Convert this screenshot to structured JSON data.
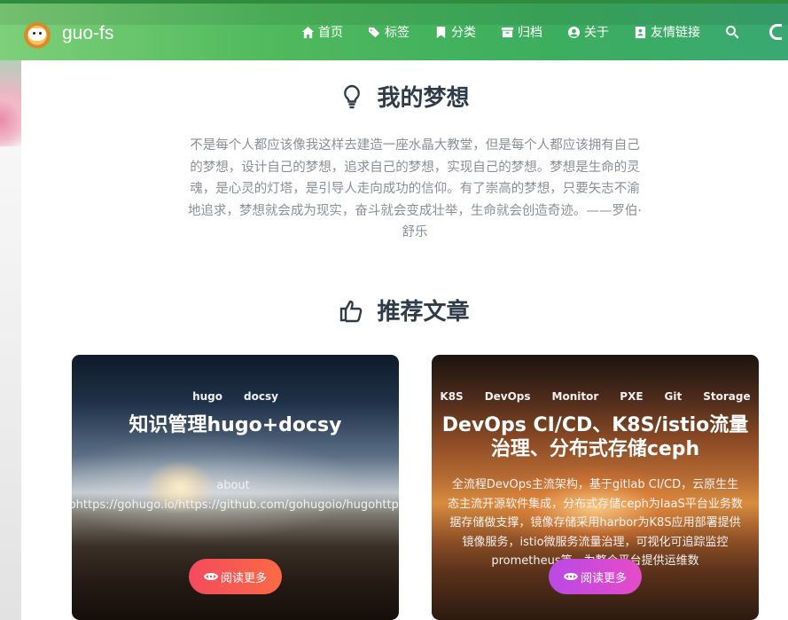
{
  "site": {
    "name": "guo-fs"
  },
  "nav": {
    "items": [
      {
        "label": "首页",
        "icon": "home-icon"
      },
      {
        "label": "标签",
        "icon": "tags-icon"
      },
      {
        "label": "分类",
        "icon": "bookmark-icon"
      },
      {
        "label": "归档",
        "icon": "archive-icon"
      },
      {
        "label": "关于",
        "icon": "user-circle-icon"
      },
      {
        "label": "友情链接",
        "icon": "address-book-icon"
      }
    ],
    "search_icon": "search-icon"
  },
  "dream": {
    "title": "我的梦想",
    "icon": "lightbulb-icon",
    "quote": "不是每个人都应该像我这样去建造一座水晶大教堂，但是每个人都应该拥有自己的梦想，设计自己的梦想，追求自己的梦想，实现自己的梦想。梦想是生命的灵魂，是心灵的灯塔，是引导人走向成功的信仰。有了崇高的梦想，只要矢志不渝地追求，梦想就会成为现实，奋斗就会变成壮举，生命就会创造奇迹。——罗伯·舒乐"
  },
  "recommend": {
    "title": "推荐文章",
    "icon": "thumbs-up-icon",
    "cards": [
      {
        "tags": [
          "hugo",
          "docsy"
        ],
        "title": "知识管理hugo+docsy",
        "desc_line1": "about",
        "desc_line2": "hugohttps://gohugo.io/https://github.com/gohugoio/hugohttps://生",
        "button": "阅读更多"
      },
      {
        "tags": [
          "K8S",
          "DevOps",
          "Monitor",
          "PXE",
          "Git",
          "Storage"
        ],
        "title": "DevOps CI/CD、K8S/istio流量治理、分布式存储ceph",
        "desc": "全流程DevOps主流架构，基于gitlab CI/CD，云原生生态主流开源软件集成，分布式存储ceph为IaaS平台业务数据存储做支撑，镜像存储采用harbor为K8S应用部署提供镜像服务，istio微服务流量治理，可视化可追踪监控prometheus等，为整个平台提供运维数",
        "button": "阅读更多"
      }
    ]
  },
  "colors": {
    "header_start": "#7ed07a",
    "header_end": "#3aa872",
    "title_text": "#2f3b48",
    "quote_text": "#8a8f96",
    "btn1": "#f44b5e",
    "btn2": "#c24ae0"
  }
}
